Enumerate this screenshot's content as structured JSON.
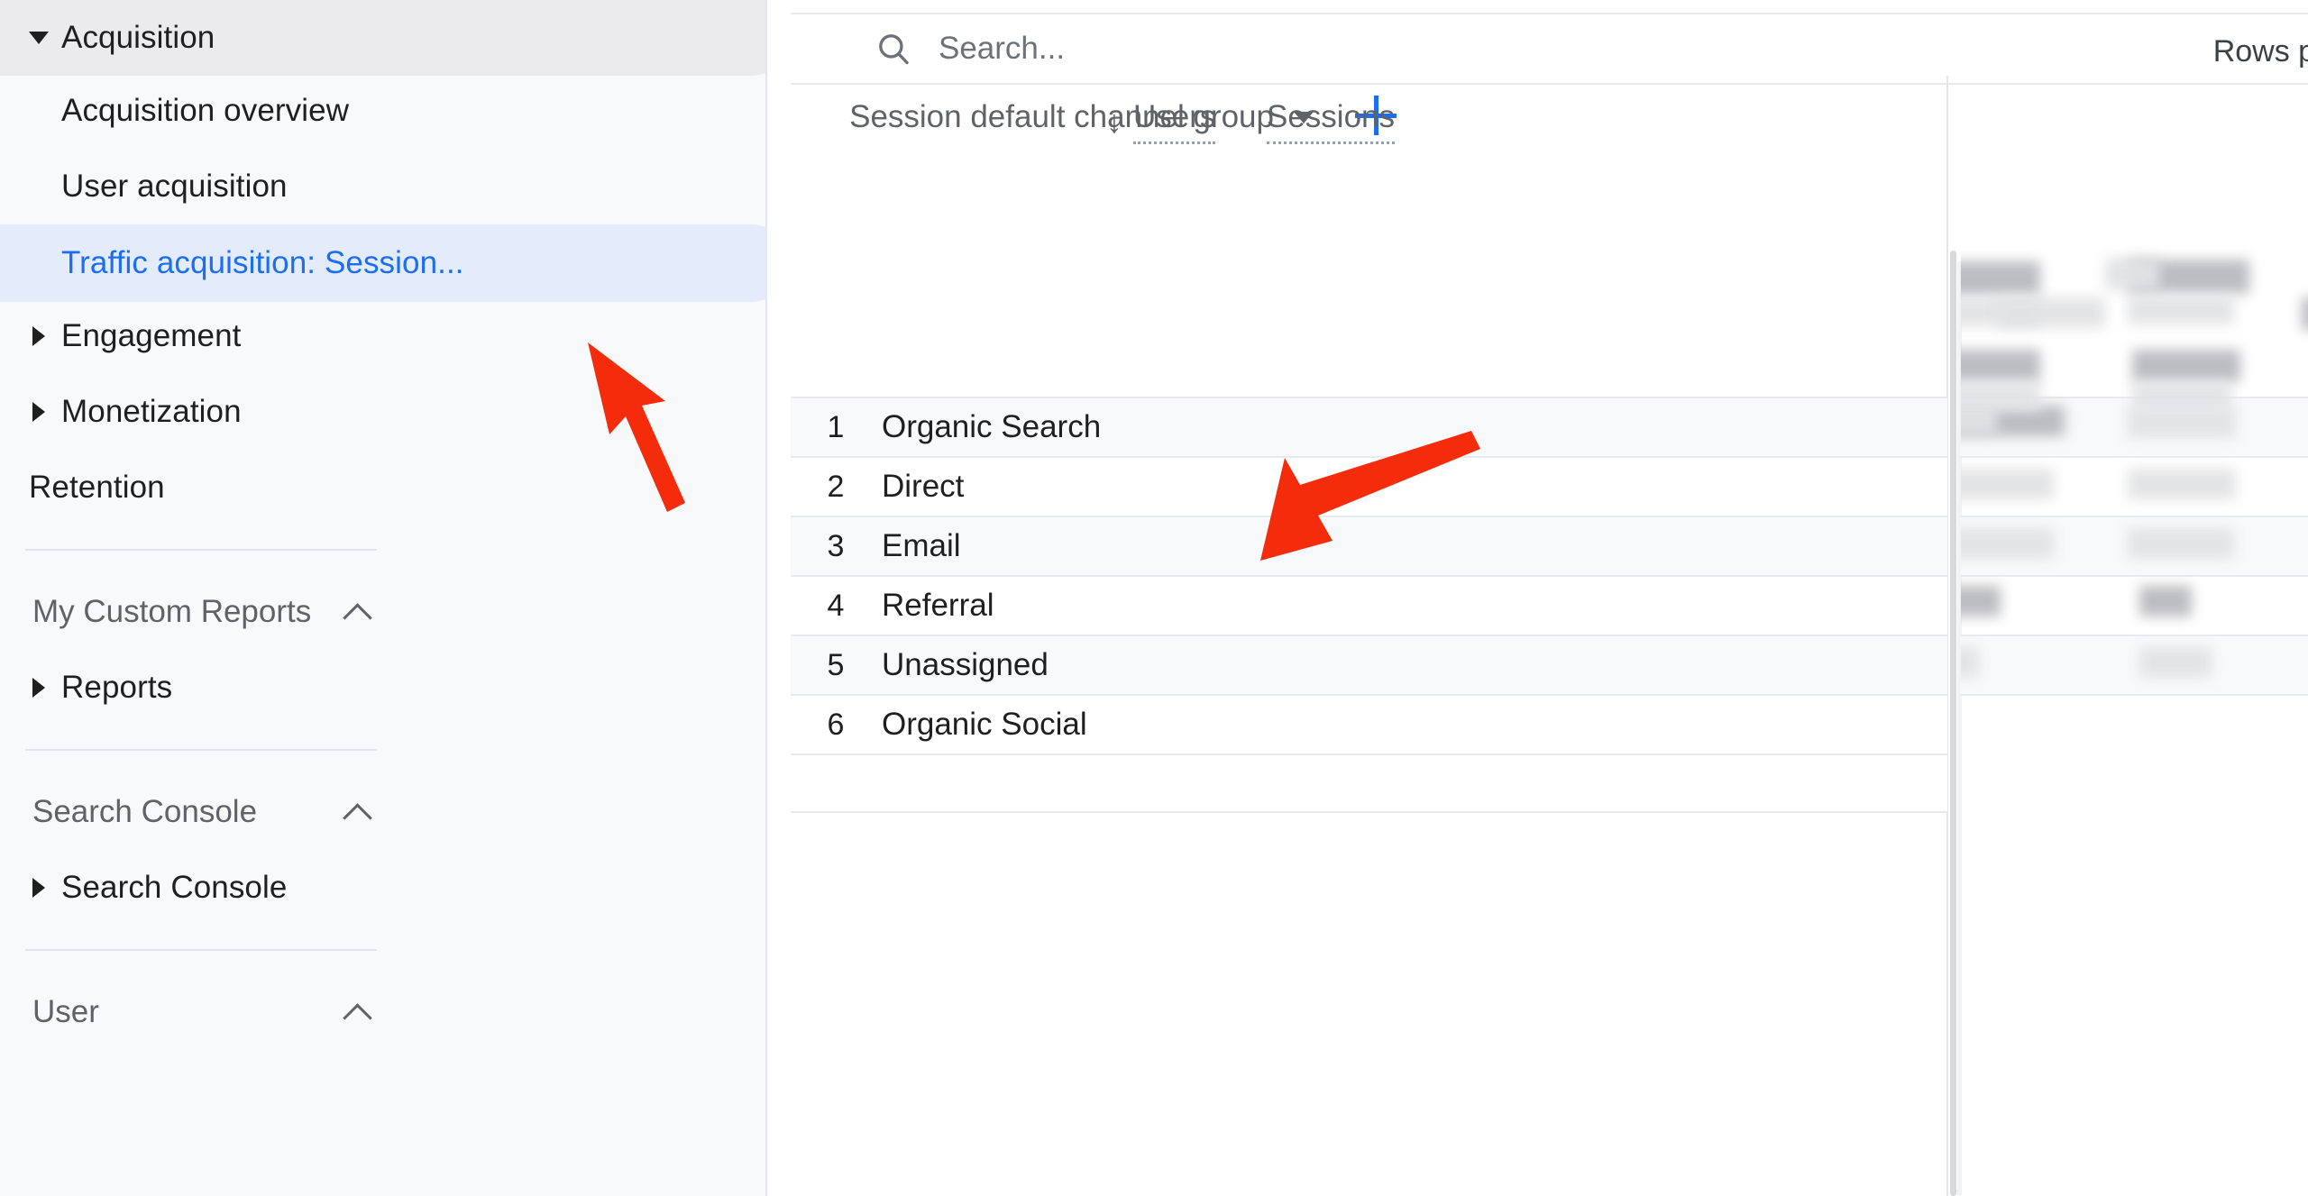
{
  "sidebar": {
    "groups": [
      {
        "id": "acquisition",
        "label": "Acquisition",
        "state": "expanded",
        "items": [
          {
            "label": "Acquisition overview",
            "active": false
          },
          {
            "label": "User acquisition",
            "active": false
          },
          {
            "label": "Traffic acquisition: Session...",
            "active": true
          }
        ]
      },
      {
        "id": "engagement",
        "label": "Engagement",
        "state": "collapsed"
      },
      {
        "id": "monetization",
        "label": "Monetization",
        "state": "collapsed"
      },
      {
        "id": "retention",
        "label": "Retention",
        "state": "none"
      }
    ],
    "sections": [
      {
        "id": "my-custom-reports",
        "label": "My Custom Reports",
        "toggle_icon": "chevron-up-icon",
        "items": [
          {
            "label": "Reports",
            "state": "collapsed"
          }
        ]
      },
      {
        "id": "search-console",
        "label": "Search Console",
        "toggle_icon": "chevron-up-icon",
        "items": [
          {
            "label": "Search Console",
            "state": "collapsed"
          }
        ]
      },
      {
        "id": "user",
        "label": "User",
        "toggle_icon": "chevron-up-icon",
        "items": []
      }
    ],
    "colors": {
      "active_text": "#1b6ef3",
      "active_bg": "#e4ecfb",
      "bg": "#f8f9fa"
    }
  },
  "main": {
    "search": {
      "icon": "search-icon",
      "placeholder": "Search...",
      "value": ""
    },
    "rows_per_page_label": "Rows pe",
    "table": {
      "dimension_header": {
        "label": "Session default channel group",
        "dropdown_icon": "chevron-down-icon",
        "add_dimension_icon": "plus-icon"
      },
      "metric_headers": [
        {
          "label": "Users",
          "sorted": true,
          "sort_icon": "arrow-down-icon"
        },
        {
          "label": "Sessions",
          "sorted": false
        }
      ],
      "rows": [
        {
          "rank": "1",
          "name": "Organic Search"
        },
        {
          "rank": "2",
          "name": "Direct"
        },
        {
          "rank": "3",
          "name": "Email"
        },
        {
          "rank": "4",
          "name": "Referral"
        },
        {
          "rank": "5",
          "name": "Unassigned"
        },
        {
          "rank": "6",
          "name": "Organic Social"
        }
      ]
    }
  },
  "annotations": {
    "arrows": [
      {
        "id": "arrow-to-sidebar-item",
        "color": "#f42c0c",
        "points_to": "Traffic acquisition: Session..."
      },
      {
        "id": "arrow-to-table-row",
        "color": "#f42c0c",
        "points_to": "Organic Search"
      }
    ]
  }
}
